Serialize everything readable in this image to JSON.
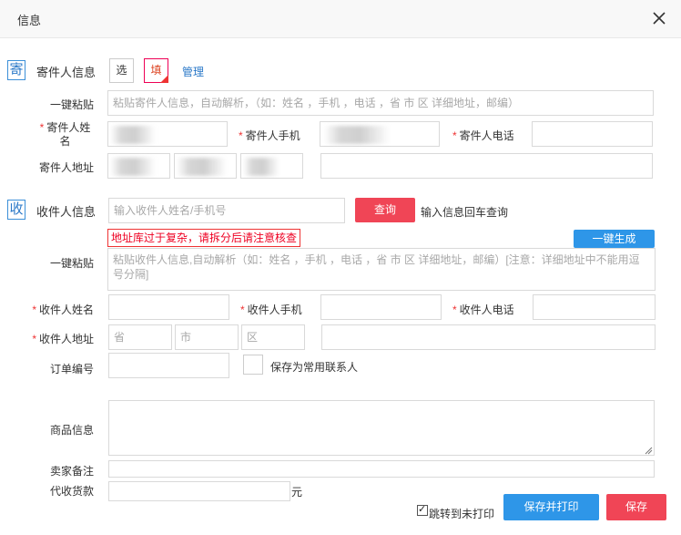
{
  "dialog": {
    "title": "信息"
  },
  "sender": {
    "section_icon": "寄",
    "section_title": "寄件人信息",
    "btn_select": "选",
    "btn_fill": "填",
    "link_manage": "管理",
    "paste_label": "一键粘贴",
    "paste_placeholder": "粘贴寄件人信息，自动解析，（如：姓名 ，手机 ，电话 ，省 市 区 详细地址，邮编）",
    "name_label": "寄件人姓名",
    "mobile_label": "寄件人手机",
    "phone_label": "寄件人电话",
    "address_label": "寄件人地址"
  },
  "receiver": {
    "section_icon": "收",
    "section_title": "收件人信息",
    "search_placeholder": "输入收件人姓名/手机号",
    "search_button": "查询",
    "search_hint": "输入信息回车查询",
    "warning": "地址库过于复杂，请拆分后请注意核查",
    "generate_button": "一键生成",
    "paste_label": "一键粘贴",
    "paste_placeholder": "粘贴收件人信息,自动解析（如：姓名 ，手机 ，电话 ，省 市 区 详细地址，邮编）[注意：详细地址中不能用逗号分隔]",
    "name_label": "收件人姓名",
    "mobile_label": "收件人手机",
    "phone_label": "收件人电话",
    "address_label": "收件人地址",
    "province_placeholder": "省",
    "city_placeholder": "市",
    "district_placeholder": "区",
    "order_label": "订单编号",
    "save_contact_label": "保存为常用联系人"
  },
  "goods": {
    "goods_label": "商品信息",
    "seller_note_label": "卖家备注",
    "cod_label": "代收货款",
    "cod_unit": "元"
  },
  "footer": {
    "jump_label": "跳转到未打印",
    "jump_checked": true,
    "save_print_button": "保存并打印",
    "save_button": "保存"
  },
  "colors": {
    "accent_blue": "#2e96e8",
    "accent_red": "#f04556",
    "link": "#2a78c8"
  },
  "icons": [
    "close-icon",
    "check-icon",
    "resize-grip-icon"
  ]
}
